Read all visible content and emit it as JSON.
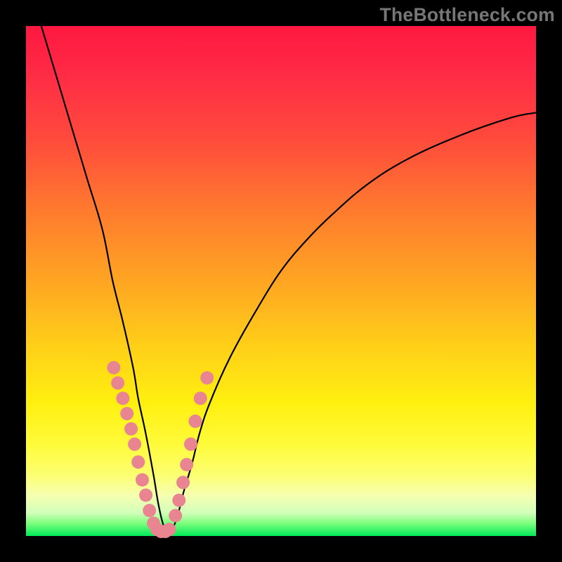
{
  "watermark": "TheBottleneck.com",
  "colors": {
    "frame": "#000000",
    "dot": "#e98591",
    "curve": "#000000",
    "gradient_stops": [
      {
        "pos": 0,
        "color": "#ff183f"
      },
      {
        "pos": 0.09,
        "color": "#ff2a46"
      },
      {
        "pos": 0.22,
        "color": "#ff4a3c"
      },
      {
        "pos": 0.36,
        "color": "#ff7a2e"
      },
      {
        "pos": 0.5,
        "color": "#ffa522"
      },
      {
        "pos": 0.63,
        "color": "#ffd018"
      },
      {
        "pos": 0.74,
        "color": "#fff010"
      },
      {
        "pos": 0.82,
        "color": "#fffb3a"
      },
      {
        "pos": 0.88,
        "color": "#fcff70"
      },
      {
        "pos": 0.92,
        "color": "#f6ffb0"
      },
      {
        "pos": 0.955,
        "color": "#d1ffba"
      },
      {
        "pos": 0.975,
        "color": "#7cff7c"
      },
      {
        "pos": 1.0,
        "color": "#00e85a"
      }
    ]
  },
  "chart_data": {
    "type": "line",
    "title": "",
    "xlabel": "",
    "ylabel": "",
    "x_range": [
      0,
      100
    ],
    "y_range": [
      0,
      100
    ],
    "note": "V-shaped bottleneck curve. x is plotted 0–100 left→right, y is 0 at bottom (green) to 100 at top (red). Minimum (optimal match) near x≈27, y≈0. Pink dots mark sampled points along the lower part of the curve near the minimum.",
    "series": [
      {
        "name": "bottleneck-curve",
        "x": [
          3,
          6,
          9,
          12,
          15,
          17,
          19,
          21,
          22,
          23.5,
          25,
          26,
          27,
          28,
          29,
          30,
          31,
          32.5,
          34,
          36,
          40,
          45,
          50,
          55,
          60,
          67,
          75,
          85,
          95,
          100
        ],
        "y": [
          100,
          90,
          80,
          70,
          60,
          50,
          42,
          33,
          27,
          20,
          12,
          6,
          2,
          1,
          2,
          5,
          9,
          14,
          20,
          26,
          35,
          44,
          52,
          58,
          63,
          69,
          74,
          78.5,
          82,
          83
        ]
      }
    ],
    "points": [
      {
        "name": "left-cluster",
        "x": [
          17.2,
          18.0,
          19.0,
          19.8,
          20.6,
          21.3,
          22.0,
          22.8,
          23.5,
          24.2,
          25.0
        ],
        "y": [
          33.0,
          30.0,
          27.0,
          24.0,
          21.0,
          18.0,
          14.5,
          11.0,
          8.0,
          5.0,
          2.5
        ]
      },
      {
        "name": "bottom",
        "x": [
          25.7,
          26.5,
          27.3,
          28.1
        ],
        "y": [
          1.3,
          0.9,
          0.9,
          1.3
        ]
      },
      {
        "name": "right-cluster",
        "x": [
          29.3,
          30.0,
          30.8,
          31.5,
          32.3,
          33.2,
          34.2,
          35.5
        ],
        "y": [
          4.0,
          7.0,
          10.5,
          14.0,
          18.0,
          22.5,
          27.0,
          31.0
        ]
      }
    ]
  }
}
